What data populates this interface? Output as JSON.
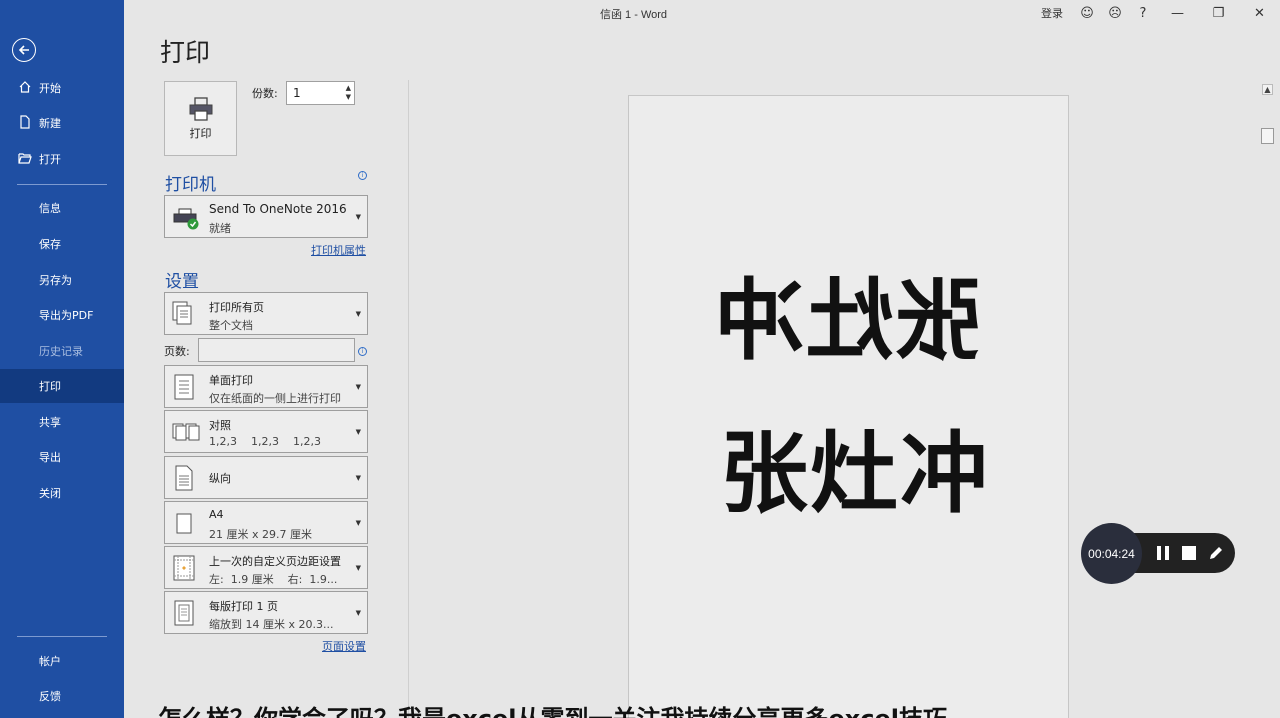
{
  "window": {
    "title": "信函 1  -  Word",
    "signin": "登录"
  },
  "sidebar": {
    "items": [
      {
        "label": "开始"
      },
      {
        "label": "新建"
      },
      {
        "label": "打开"
      },
      {
        "label": "信息"
      },
      {
        "label": "保存"
      },
      {
        "label": "另存为"
      },
      {
        "label": "导出为PDF"
      },
      {
        "label": "历史记录"
      },
      {
        "label": "打印"
      },
      {
        "label": "共享"
      },
      {
        "label": "导出"
      },
      {
        "label": "关闭"
      },
      {
        "label": "帐户"
      },
      {
        "label": "反馈"
      }
    ]
  },
  "print": {
    "page_title": "打印",
    "print_button_label": "打印",
    "copies_label": "份数:",
    "copies_value": "1",
    "printer_heading": "打印机",
    "printer_name": "Send To OneNote 2016",
    "printer_status": "就绪",
    "printer_properties_link": "打印机属性",
    "settings_heading": "设置",
    "settings": [
      {
        "line1": "打印所有页",
        "line2": "整个文档"
      },
      {
        "line1": "单面打印",
        "line2": "仅在纸面的一侧上进行打印"
      },
      {
        "line1": "对照",
        "line2": "1,2,3    1,2,3    1,2,3"
      },
      {
        "line1": "纵向",
        "line2": ""
      },
      {
        "line1": "A4",
        "line2": "21 厘米 x 29.7 厘米"
      },
      {
        "line1": "上一次的自定义页边距设置",
        "line2": "左:  1.9 厘米    右:  1.9..."
      },
      {
        "line1": "每版打印 1 页",
        "line2": "缩放到 14 厘米 x 20.3..."
      }
    ],
    "pages_label": "页数:",
    "pages_value": "",
    "page_setup_link": "页面设置"
  },
  "preview": {
    "mirrored_text": "张灶冲",
    "normal_text": "张灶冲"
  },
  "recorder": {
    "time": "00:04:24"
  },
  "caption": "怎么样？你学会了吗？我是excel从零到一关注我持续分享更多excel技巧",
  "colors": {
    "sidebar": "#1f4fa3",
    "accent": "#1f4fa3",
    "active_nav": "#123a80"
  }
}
